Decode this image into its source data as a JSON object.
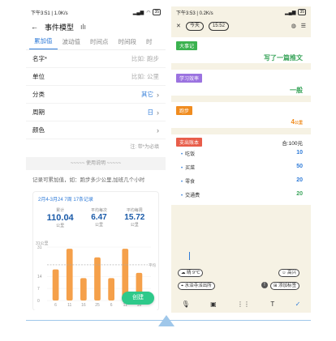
{
  "left": {
    "status": {
      "time": "下午3:51 | 1.0K/s",
      "signal": "4G",
      "battery": "35"
    },
    "header": {
      "title": "事件模型"
    },
    "tabs": [
      "累加值",
      "波动值",
      "时间点",
      "时间段",
      "时"
    ],
    "fields": [
      {
        "label": "名字*",
        "value": "比如: 跑步"
      },
      {
        "label": "单位",
        "value": "比如: 公里"
      },
      {
        "label": "分类",
        "value": "其它"
      },
      {
        "label": "周期",
        "value": "日"
      },
      {
        "label": "颜色",
        "value": ""
      }
    ],
    "note": "注: 带*为必填",
    "usage": "~~~~~ 使用说明 ~~~~~",
    "description": "记录可累加值，如：跑步多少公里,加班几个小时",
    "card": {
      "date_range": "2月4-3月24",
      "days": "7周",
      "records": "17条记录",
      "stats": [
        {
          "label": "累计",
          "value": "110.04",
          "unit": "公里"
        },
        {
          "label": "平均每次",
          "value": "6.47",
          "unit": "公里"
        },
        {
          "label": "平均每周",
          "value": "15.72",
          "unit": "公里"
        }
      ]
    },
    "chart_data": {
      "type": "bar",
      "ylabel": "31公里",
      "avg_label": "平均",
      "yticks": [
        "31",
        "14",
        "7",
        "0"
      ],
      "categories": [
        "6",
        "11",
        "16",
        "25",
        "6",
        "11",
        "16"
      ],
      "values": [
        18,
        30,
        13,
        25,
        13,
        30,
        16
      ],
      "ylim": [
        0,
        31
      ],
      "color": "#f5a04a"
    },
    "create_label": "创建"
  },
  "right": {
    "status": {
      "time": "下午3:53 | 0.2K/s",
      "battery": "35"
    },
    "header": {
      "today": "今天",
      "time": "15:52"
    },
    "blocks": [
      {
        "tag": "大事记",
        "tag_color": "#3bb24f",
        "value": "写了一篇推文"
      },
      {
        "tag": "学习效率",
        "tag_color": "#9b73e0",
        "value": "一般"
      },
      {
        "tag": "跑步",
        "tag_color": "#f08c1f",
        "value": "4",
        "unit": "公里"
      }
    ],
    "expense": {
      "tag": "支出账本",
      "tag_color": "#e85d4a",
      "total": "合:100元",
      "items": [
        {
          "name": "吃饭",
          "amount": "10"
        },
        {
          "name": "买菜",
          "amount": "50"
        },
        {
          "name": "零食",
          "amount": "20"
        },
        {
          "name": "交通费",
          "amount": "20"
        }
      ]
    },
    "chips": {
      "weather": "晴 9℃",
      "mood": "高兴",
      "location": "水泊寺派出所",
      "tag": "添加标签"
    }
  }
}
